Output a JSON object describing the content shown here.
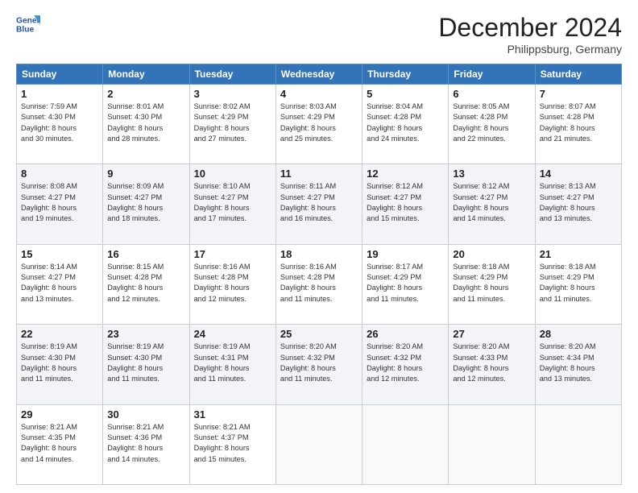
{
  "header": {
    "logo_line1": "General",
    "logo_line2": "Blue",
    "month": "December 2024",
    "location": "Philippsburg, Germany"
  },
  "days_of_week": [
    "Sunday",
    "Monday",
    "Tuesday",
    "Wednesday",
    "Thursday",
    "Friday",
    "Saturday"
  ],
  "weeks": [
    [
      {
        "day": "1",
        "info": "Sunrise: 7:59 AM\nSunset: 4:30 PM\nDaylight: 8 hours\nand 30 minutes."
      },
      {
        "day": "2",
        "info": "Sunrise: 8:01 AM\nSunset: 4:30 PM\nDaylight: 8 hours\nand 28 minutes."
      },
      {
        "day": "3",
        "info": "Sunrise: 8:02 AM\nSunset: 4:29 PM\nDaylight: 8 hours\nand 27 minutes."
      },
      {
        "day": "4",
        "info": "Sunrise: 8:03 AM\nSunset: 4:29 PM\nDaylight: 8 hours\nand 25 minutes."
      },
      {
        "day": "5",
        "info": "Sunrise: 8:04 AM\nSunset: 4:28 PM\nDaylight: 8 hours\nand 24 minutes."
      },
      {
        "day": "6",
        "info": "Sunrise: 8:05 AM\nSunset: 4:28 PM\nDaylight: 8 hours\nand 22 minutes."
      },
      {
        "day": "7",
        "info": "Sunrise: 8:07 AM\nSunset: 4:28 PM\nDaylight: 8 hours\nand 21 minutes."
      }
    ],
    [
      {
        "day": "8",
        "info": "Sunrise: 8:08 AM\nSunset: 4:27 PM\nDaylight: 8 hours\nand 19 minutes."
      },
      {
        "day": "9",
        "info": "Sunrise: 8:09 AM\nSunset: 4:27 PM\nDaylight: 8 hours\nand 18 minutes."
      },
      {
        "day": "10",
        "info": "Sunrise: 8:10 AM\nSunset: 4:27 PM\nDaylight: 8 hours\nand 17 minutes."
      },
      {
        "day": "11",
        "info": "Sunrise: 8:11 AM\nSunset: 4:27 PM\nDaylight: 8 hours\nand 16 minutes."
      },
      {
        "day": "12",
        "info": "Sunrise: 8:12 AM\nSunset: 4:27 PM\nDaylight: 8 hours\nand 15 minutes."
      },
      {
        "day": "13",
        "info": "Sunrise: 8:12 AM\nSunset: 4:27 PM\nDaylight: 8 hours\nand 14 minutes."
      },
      {
        "day": "14",
        "info": "Sunrise: 8:13 AM\nSunset: 4:27 PM\nDaylight: 8 hours\nand 13 minutes."
      }
    ],
    [
      {
        "day": "15",
        "info": "Sunrise: 8:14 AM\nSunset: 4:27 PM\nDaylight: 8 hours\nand 13 minutes."
      },
      {
        "day": "16",
        "info": "Sunrise: 8:15 AM\nSunset: 4:28 PM\nDaylight: 8 hours\nand 12 minutes."
      },
      {
        "day": "17",
        "info": "Sunrise: 8:16 AM\nSunset: 4:28 PM\nDaylight: 8 hours\nand 12 minutes."
      },
      {
        "day": "18",
        "info": "Sunrise: 8:16 AM\nSunset: 4:28 PM\nDaylight: 8 hours\nand 11 minutes."
      },
      {
        "day": "19",
        "info": "Sunrise: 8:17 AM\nSunset: 4:29 PM\nDaylight: 8 hours\nand 11 minutes."
      },
      {
        "day": "20",
        "info": "Sunrise: 8:18 AM\nSunset: 4:29 PM\nDaylight: 8 hours\nand 11 minutes."
      },
      {
        "day": "21",
        "info": "Sunrise: 8:18 AM\nSunset: 4:29 PM\nDaylight: 8 hours\nand 11 minutes."
      }
    ],
    [
      {
        "day": "22",
        "info": "Sunrise: 8:19 AM\nSunset: 4:30 PM\nDaylight: 8 hours\nand 11 minutes."
      },
      {
        "day": "23",
        "info": "Sunrise: 8:19 AM\nSunset: 4:30 PM\nDaylight: 8 hours\nand 11 minutes."
      },
      {
        "day": "24",
        "info": "Sunrise: 8:19 AM\nSunset: 4:31 PM\nDaylight: 8 hours\nand 11 minutes."
      },
      {
        "day": "25",
        "info": "Sunrise: 8:20 AM\nSunset: 4:32 PM\nDaylight: 8 hours\nand 11 minutes."
      },
      {
        "day": "26",
        "info": "Sunrise: 8:20 AM\nSunset: 4:32 PM\nDaylight: 8 hours\nand 12 minutes."
      },
      {
        "day": "27",
        "info": "Sunrise: 8:20 AM\nSunset: 4:33 PM\nDaylight: 8 hours\nand 12 minutes."
      },
      {
        "day": "28",
        "info": "Sunrise: 8:20 AM\nSunset: 4:34 PM\nDaylight: 8 hours\nand 13 minutes."
      }
    ],
    [
      {
        "day": "29",
        "info": "Sunrise: 8:21 AM\nSunset: 4:35 PM\nDaylight: 8 hours\nand 14 minutes."
      },
      {
        "day": "30",
        "info": "Sunrise: 8:21 AM\nSunset: 4:36 PM\nDaylight: 8 hours\nand 14 minutes."
      },
      {
        "day": "31",
        "info": "Sunrise: 8:21 AM\nSunset: 4:37 PM\nDaylight: 8 hours\nand 15 minutes."
      },
      {
        "day": "",
        "info": ""
      },
      {
        "day": "",
        "info": ""
      },
      {
        "day": "",
        "info": ""
      },
      {
        "day": "",
        "info": ""
      }
    ]
  ]
}
